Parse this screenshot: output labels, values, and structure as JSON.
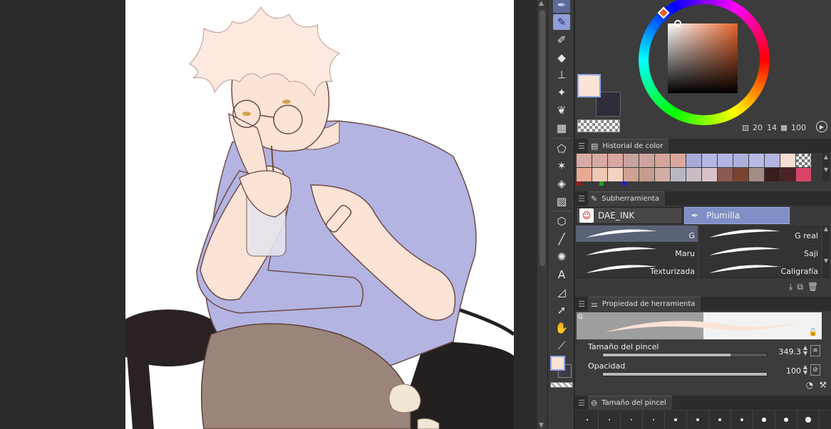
{
  "color": {
    "main": "#fbe3d6",
    "sub": "#2e2d38",
    "hue": "#e8652c",
    "info": [
      "20",
      "14",
      "100"
    ]
  },
  "history": {
    "title": "Historial de color",
    "row1": [
      "#d8aaa4",
      "#d7aba3",
      "#d8a7a2",
      "#c8a29e",
      "#cda59f",
      "#d4a69b",
      "#dba79b",
      "#a8aad8",
      "#b4b7e2",
      "#b2b5e3",
      "#adb0dd",
      "#b7bae6",
      "#b3b5e2",
      "#f8dcd2",
      "checker"
    ],
    "row2": [
      "#e8aa95",
      "#f0c8b6",
      "#f6d2c3",
      "#cfa195",
      "#c89c8f",
      "#d2ada6",
      "#b8b8c4",
      "#c9bcc4",
      "#d8c2c8",
      "#8c5a4e",
      "#7a4432",
      "#a58c84",
      "#3a1e1c",
      "#4b2225",
      "#d9466a"
    ],
    "dots": [
      "#b01515",
      "#1fa31f",
      "#1a1ad4"
    ]
  },
  "subtool": {
    "title": "Subherramienta",
    "tabs": [
      "DAE_INK",
      "Plumilla"
    ],
    "brushes": [
      {
        "label": "G",
        "active": true
      },
      {
        "label": "G real",
        "active": false
      },
      {
        "label": "Maru",
        "active": false
      },
      {
        "label": "Saji",
        "active": false
      },
      {
        "label": "Texturizada",
        "active": false
      },
      {
        "label": "Caligrafía",
        "active": false
      }
    ]
  },
  "toolprop": {
    "title": "Propiedad de herramienta",
    "preview_label": "G",
    "brush_size_label": "Tamaño del pincel",
    "brush_size_value": "349.3",
    "brush_size_fraction": 0.78,
    "opacity_label": "Opacidad",
    "opacity_value": "100",
    "opacity_fraction": 1.0
  },
  "brushsize": {
    "title": "Tamaño del pincel",
    "dots": [
      1,
      1.5,
      2,
      2,
      2.5,
      3,
      3,
      3.5,
      4,
      4.5,
      5.5
    ]
  },
  "toolbar": {
    "tools": [
      "pen-nib-icon",
      "pen-icon",
      "marker-icon",
      "eraser-icon",
      "stamp-icon",
      "sparkle-icon",
      "water-drop-icon",
      "frame-icon",
      "lasso-icon",
      "magic-wand-icon",
      "fill-bucket-icon",
      "gradient-icon",
      "cube-icon",
      "line-icon",
      "burst-icon",
      "text-icon",
      "ruler-icon",
      "select-arrow-icon",
      "hand-icon",
      "eyedropper-icon"
    ]
  }
}
